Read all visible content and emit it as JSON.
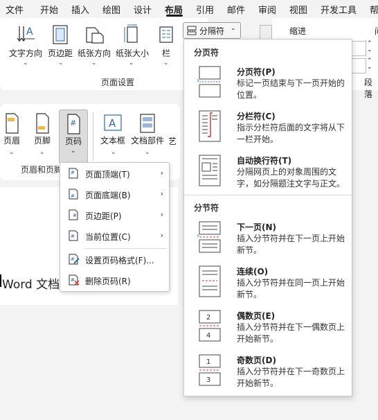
{
  "menubar": {
    "tabs": [
      "文件",
      "开始",
      "插入",
      "绘图",
      "设计",
      "布局",
      "引用",
      "邮件",
      "审阅",
      "视图",
      "开发工具",
      "帮"
    ],
    "active": "布局"
  },
  "ribbon_top": {
    "buttons": {
      "text_direction": "文字方向",
      "margins": "页边距",
      "orientation": "纸张方向",
      "size": "纸张大小",
      "columns": "栏"
    },
    "breaks_button": "分隔符",
    "indent_label": "缩进",
    "spacing_label": "段落",
    "group_label": "页面设置",
    "right_edge_label": "间"
  },
  "ribbon_insert": {
    "buttons": {
      "header": "页眉",
      "footer": "页脚",
      "page_number": "页码",
      "textbox": "文本框",
      "quick_parts": "文档部件",
      "wordart": "艺"
    },
    "group_label": "页眉和页脚"
  },
  "document": {
    "text": "Word 文档"
  },
  "page_number_menu": {
    "items": [
      {
        "label": "页面顶端(T)",
        "submenu": true
      },
      {
        "label": "页面底端(B)",
        "submenu": true
      },
      {
        "label": "页边距(P)",
        "submenu": true
      },
      {
        "label": "当前位置(C)",
        "submenu": true
      },
      {
        "label": "设置页码格式(F)...",
        "submenu": false
      },
      {
        "label": "删除页码(R)",
        "submenu": false
      }
    ]
  },
  "breaks_menu": {
    "section_page": "分页符",
    "section_section": "分节符",
    "page_breaks": [
      {
        "title": "分页符(P)",
        "desc": "标记一页结束与下一页开始的位置。"
      },
      {
        "title": "分栏符(C)",
        "desc": "指示分栏符后面的文字将从下一栏开始。"
      },
      {
        "title": "自动换行符(T)",
        "desc": "分隔网页上的对象周围的文字，如分隔题注文字与正文。"
      }
    ],
    "section_breaks": [
      {
        "title": "下一页(N)",
        "desc": "插入分节符并在下一页上开始新节。"
      },
      {
        "title": "连续(O)",
        "desc": "插入分节符并在同一页上开始新节。"
      },
      {
        "title": "偶数页(E)",
        "desc": "插入分节符并在下一偶数页上开始新节。"
      },
      {
        "title": "奇数页(D)",
        "desc": "插入分节符并在下一奇数页上开始新节。"
      }
    ],
    "even_labels": [
      "2",
      "4"
    ],
    "odd_labels": [
      "1",
      "3"
    ]
  },
  "colors": {
    "accent": "#2b6cb0",
    "red": "#d9302c",
    "border": "#c8c8c8"
  }
}
